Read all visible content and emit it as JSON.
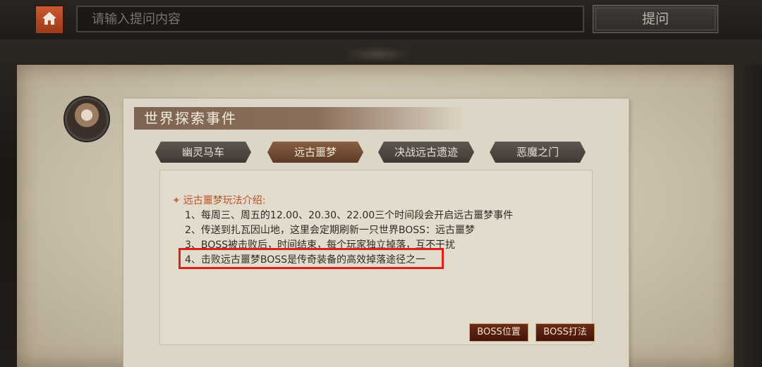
{
  "top_bar": {
    "home_icon": "home-icon",
    "search_placeholder": "请输入提问内容",
    "ask_label": "提问"
  },
  "panel": {
    "title": "世界探索事件",
    "tabs": [
      {
        "label": "幽灵马车",
        "active": false
      },
      {
        "label": "远古噩梦",
        "active": true
      },
      {
        "label": "决战远古遗迹",
        "active": false
      },
      {
        "label": "恶魔之门",
        "active": false
      }
    ],
    "content": {
      "heading": "远古噩梦玩法介绍:",
      "lines": [
        "1、每周三、周五的12.00、20.30、22.00三个时间段会开启远古噩梦事件",
        "2、传送到扎瓦因山地，这里会定期刷新一只世界BOSS：远古噩梦",
        "3、BOSS被击败后，时间结束，每个玩家独立掉落，互不干扰",
        "4、击败远古噩梦BOSS是传奇装备的高效掉落途径之一"
      ]
    },
    "buttons": {
      "boss_location": "BOSS位置",
      "boss_strategy": "BOSS打法"
    }
  },
  "colors": {
    "highlight_box": "#e0201d",
    "heading": "#b4532a",
    "active_tab": "#7a4f36",
    "home_button": "#b84a22"
  }
}
